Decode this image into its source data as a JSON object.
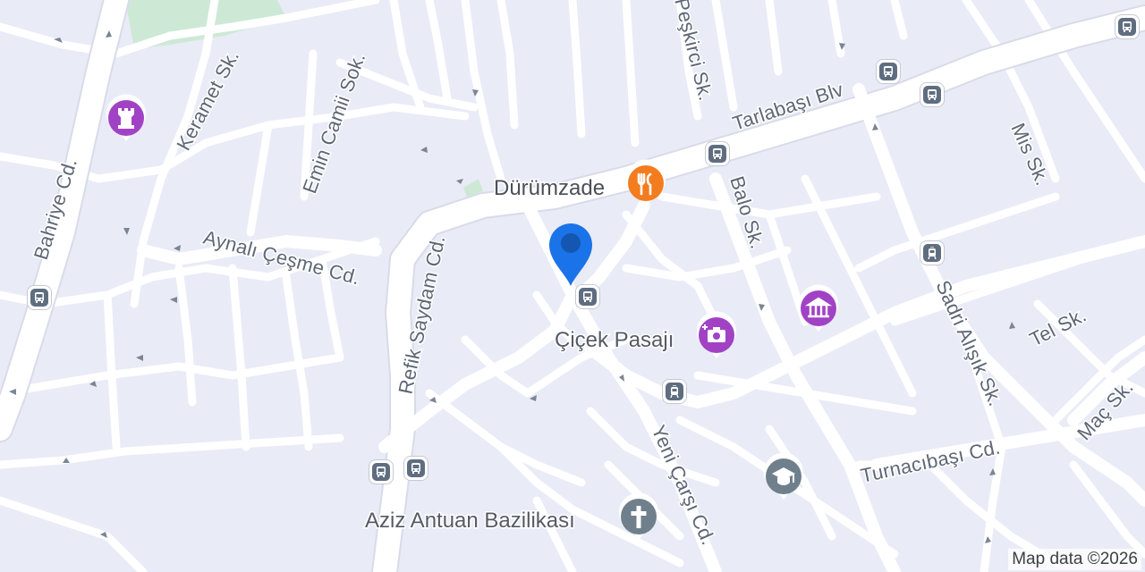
{
  "map": {
    "attribution": "Map data ©2026",
    "colors": {
      "land": "#e9ebf7",
      "road": "#ffffff",
      "road_outline": "#d6d9e6",
      "park": "#c9e8d4",
      "label": "#5d6775",
      "transit_icon": "#5f6d80",
      "poi_purple": "#a142c5",
      "poi_orange": "#f37c1f",
      "poi_gray": "#6f7f8c",
      "location_pin": "#1a73e8"
    },
    "streets": [
      {
        "id": "bahriye",
        "label": "Bahriye Cd."
      },
      {
        "id": "keramet",
        "label": "Keramet Sk."
      },
      {
        "id": "emin-camii",
        "label": "Emin Camii Sok."
      },
      {
        "id": "aynali-cesme",
        "label": "Aynalı Çeşme Cd."
      },
      {
        "id": "refik-saydam",
        "label": "Refik Saydam Cd."
      },
      {
        "id": "peskirci",
        "label": "Peşkirci Sk."
      },
      {
        "id": "tarlabasi",
        "label": "Tarlabaşı Blv"
      },
      {
        "id": "balo",
        "label": "Balo Sk."
      },
      {
        "id": "mis",
        "label": "Mis Sk."
      },
      {
        "id": "sadri-alisik",
        "label": "Sadri Alışık Sk."
      },
      {
        "id": "tel",
        "label": "Tel Sk."
      },
      {
        "id": "mac",
        "label": "Maç Sk."
      },
      {
        "id": "turnacibasi",
        "label": "Turnacıbaşı Cd."
      },
      {
        "id": "yeni-carsi",
        "label": "Yeni Çarşı Cd."
      }
    ],
    "pois": [
      {
        "id": "durumzade",
        "label": "Dürümzade",
        "icon": "restaurant-icon"
      },
      {
        "id": "cicek-pasaji",
        "label": "Çiçek Pasajı",
        "icon": "camera-icon"
      },
      {
        "id": "aziz-antuan",
        "label": "Aziz Antuan Bazilikası",
        "icon": "church-cross-icon"
      },
      {
        "id": "museum",
        "label": "",
        "icon": "museum-icon"
      },
      {
        "id": "school",
        "label": "",
        "icon": "graduation-cap-icon"
      },
      {
        "id": "castle",
        "label": "",
        "icon": "castle-icon"
      }
    ],
    "transit_stops": [
      {
        "type": "bus",
        "icon": "bus-stop-icon"
      },
      {
        "type": "tram",
        "icon": "tram-stop-icon"
      }
    ],
    "current_location": {
      "icon": "location-pin-icon"
    }
  }
}
